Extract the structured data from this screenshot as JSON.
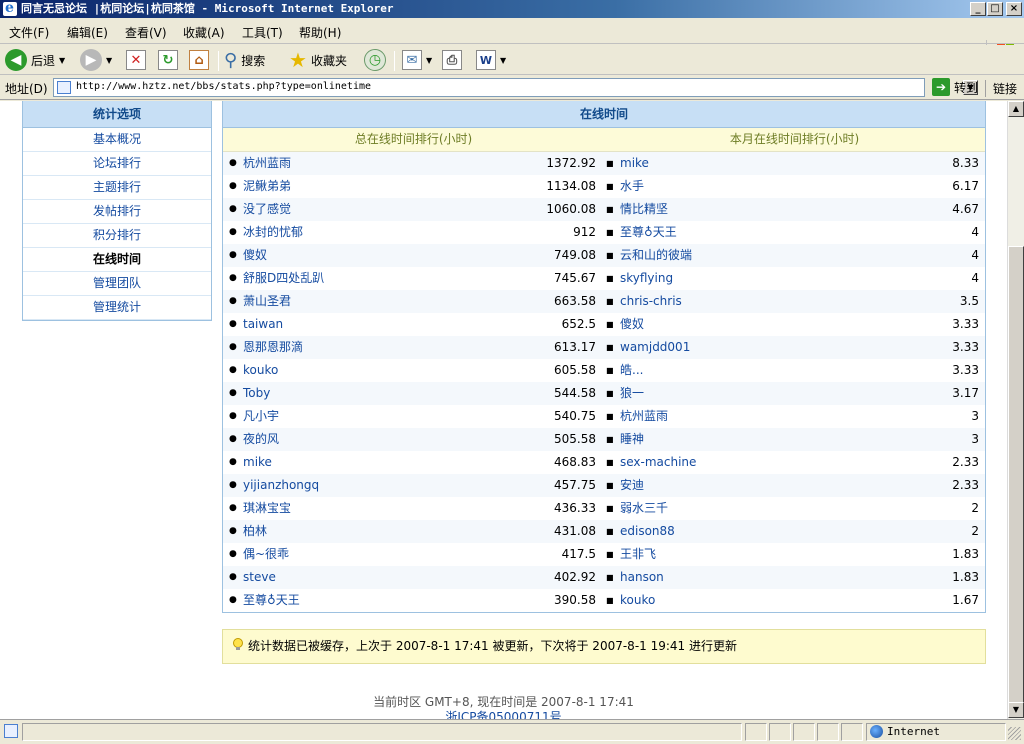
{
  "window": {
    "title": "同言无忌论坛 |杭同论坛|杭同茶馆 - Microsoft Internet Explorer",
    "min_label": "_",
    "max_label": "□",
    "close_label": "×"
  },
  "menu": [
    "文件(F)",
    "编辑(E)",
    "查看(V)",
    "收藏(A)",
    "工具(T)",
    "帮助(H)"
  ],
  "toolbar": {
    "back_label": "后退",
    "search_label": "搜索",
    "favorites_label": "收藏夹"
  },
  "address": {
    "label": "地址(D)",
    "url": "http://www.hztz.net/bbs/stats.php?type=onlinetime",
    "go_label": "转到",
    "links_label": "链接"
  },
  "sidebar": {
    "title": "统计选项",
    "items": [
      "基本概况",
      "论坛排行",
      "主题排行",
      "发帖排行",
      "积分排行",
      "在线时间",
      "管理团队",
      "管理统计"
    ],
    "active": "在线时间"
  },
  "main": {
    "title": "在线时间",
    "left_header": "总在线时间排行(小时)",
    "right_header": "本月在线时间排行(小时)",
    "left_rows": [
      {
        "name": "杭州蓝雨",
        "value": "1372.92"
      },
      {
        "name": "泥鳅弟弟",
        "value": "1134.08"
      },
      {
        "name": "没了感觉",
        "value": "1060.08"
      },
      {
        "name": "冰封的忧郁",
        "value": "912"
      },
      {
        "name": "傻奴",
        "value": "749.08"
      },
      {
        "name": "舒服D四处乱趴",
        "value": "745.67"
      },
      {
        "name": "萧山圣君",
        "value": "663.58"
      },
      {
        "name": "taiwan",
        "value": "652.5"
      },
      {
        "name": "恩那恩那滴",
        "value": "613.17"
      },
      {
        "name": "kouko",
        "value": "605.58"
      },
      {
        "name": "Toby",
        "value": "544.58"
      },
      {
        "name": "凡小宇",
        "value": "540.75"
      },
      {
        "name": "夜的风",
        "value": "505.58"
      },
      {
        "name": "mike",
        "value": "468.83"
      },
      {
        "name": "yijianzhongq",
        "value": "457.75"
      },
      {
        "name": "琪淋宝宝",
        "value": "436.33"
      },
      {
        "name": "柏林",
        "value": "431.08"
      },
      {
        "name": "偶~很乖",
        "value": "417.5"
      },
      {
        "name": "steve",
        "value": "402.92"
      },
      {
        "name": "至尊♁天王",
        "value": "390.58"
      }
    ],
    "right_rows": [
      {
        "name": "mike",
        "value": "8.33"
      },
      {
        "name": "水手",
        "value": "6.17"
      },
      {
        "name": "情比精坚",
        "value": "4.67"
      },
      {
        "name": "至尊♁天王",
        "value": "4"
      },
      {
        "name": "云和山的彼端",
        "value": "4"
      },
      {
        "name": "skyflying",
        "value": "4"
      },
      {
        "name": "chris-chris",
        "value": "3.5"
      },
      {
        "name": "傻奴",
        "value": "3.33"
      },
      {
        "name": "wamjdd001",
        "value": "3.33"
      },
      {
        "name": "皓...",
        "value": "3.33"
      },
      {
        "name": "狼一",
        "value": "3.17"
      },
      {
        "name": "杭州蓝雨",
        "value": "3"
      },
      {
        "name": "睡神",
        "value": "3"
      },
      {
        "name": "sex-machine",
        "value": "2.33"
      },
      {
        "name": "安迪",
        "value": "2.33"
      },
      {
        "name": "弱水三千",
        "value": "2"
      },
      {
        "name": "edison88",
        "value": "2"
      },
      {
        "name": "王非飞",
        "value": "1.83"
      },
      {
        "name": "hanson",
        "value": "1.83"
      },
      {
        "name": "kouko",
        "value": "1.67"
      }
    ]
  },
  "notice": "统计数据已被缓存，上次于 2007-8-1 17:41 被更新，下次将于 2007-8-1 19:41 进行更新",
  "footer": {
    "time": "当前时区 GMT+8, 现在时间是 2007-8-1 17:41",
    "icp": "浙ICP备05000711号"
  },
  "status": {
    "zone": "Internet"
  },
  "icons": [
    "ie-icon",
    "back-icon",
    "forward-icon",
    "stop-icon",
    "refresh-icon",
    "home-icon",
    "search-icon",
    "favorites-star-icon",
    "history-icon",
    "mail-icon",
    "print-icon",
    "edit-icon",
    "page-icon",
    "go-icon",
    "bulb-icon",
    "globe-icon",
    "windows-logo-icon"
  ],
  "colors": {
    "link": "#154ba0",
    "header_bg": "#c7dff5",
    "subheader_bg": "#fdfbd8",
    "notice_bg": "#fefbcf"
  }
}
